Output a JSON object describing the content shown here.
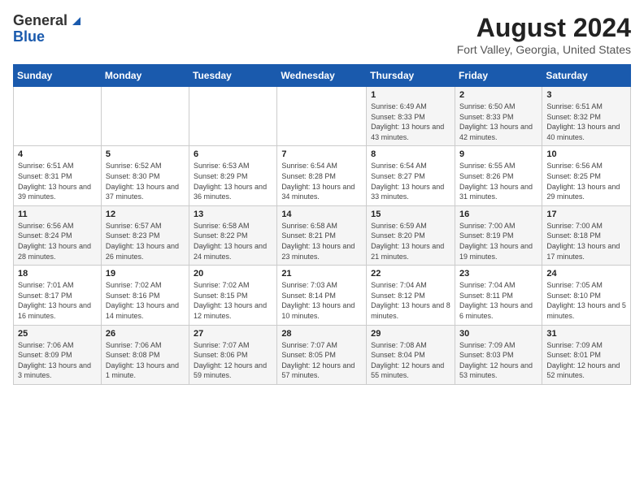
{
  "header": {
    "logo_general": "General",
    "logo_blue": "Blue",
    "month_title": "August 2024",
    "location": "Fort Valley, Georgia, United States"
  },
  "weekdays": [
    "Sunday",
    "Monday",
    "Tuesday",
    "Wednesday",
    "Thursday",
    "Friday",
    "Saturday"
  ],
  "weeks": [
    [
      {
        "day": "",
        "sunrise": "",
        "sunset": "",
        "daylight": ""
      },
      {
        "day": "",
        "sunrise": "",
        "sunset": "",
        "daylight": ""
      },
      {
        "day": "",
        "sunrise": "",
        "sunset": "",
        "daylight": ""
      },
      {
        "day": "",
        "sunrise": "",
        "sunset": "",
        "daylight": ""
      },
      {
        "day": "1",
        "sunrise": "Sunrise: 6:49 AM",
        "sunset": "Sunset: 8:33 PM",
        "daylight": "Daylight: 13 hours and 43 minutes."
      },
      {
        "day": "2",
        "sunrise": "Sunrise: 6:50 AM",
        "sunset": "Sunset: 8:33 PM",
        "daylight": "Daylight: 13 hours and 42 minutes."
      },
      {
        "day": "3",
        "sunrise": "Sunrise: 6:51 AM",
        "sunset": "Sunset: 8:32 PM",
        "daylight": "Daylight: 13 hours and 40 minutes."
      }
    ],
    [
      {
        "day": "4",
        "sunrise": "Sunrise: 6:51 AM",
        "sunset": "Sunset: 8:31 PM",
        "daylight": "Daylight: 13 hours and 39 minutes."
      },
      {
        "day": "5",
        "sunrise": "Sunrise: 6:52 AM",
        "sunset": "Sunset: 8:30 PM",
        "daylight": "Daylight: 13 hours and 37 minutes."
      },
      {
        "day": "6",
        "sunrise": "Sunrise: 6:53 AM",
        "sunset": "Sunset: 8:29 PM",
        "daylight": "Daylight: 13 hours and 36 minutes."
      },
      {
        "day": "7",
        "sunrise": "Sunrise: 6:54 AM",
        "sunset": "Sunset: 8:28 PM",
        "daylight": "Daylight: 13 hours and 34 minutes."
      },
      {
        "day": "8",
        "sunrise": "Sunrise: 6:54 AM",
        "sunset": "Sunset: 8:27 PM",
        "daylight": "Daylight: 13 hours and 33 minutes."
      },
      {
        "day": "9",
        "sunrise": "Sunrise: 6:55 AM",
        "sunset": "Sunset: 8:26 PM",
        "daylight": "Daylight: 13 hours and 31 minutes."
      },
      {
        "day": "10",
        "sunrise": "Sunrise: 6:56 AM",
        "sunset": "Sunset: 8:25 PM",
        "daylight": "Daylight: 13 hours and 29 minutes."
      }
    ],
    [
      {
        "day": "11",
        "sunrise": "Sunrise: 6:56 AM",
        "sunset": "Sunset: 8:24 PM",
        "daylight": "Daylight: 13 hours and 28 minutes."
      },
      {
        "day": "12",
        "sunrise": "Sunrise: 6:57 AM",
        "sunset": "Sunset: 8:23 PM",
        "daylight": "Daylight: 13 hours and 26 minutes."
      },
      {
        "day": "13",
        "sunrise": "Sunrise: 6:58 AM",
        "sunset": "Sunset: 8:22 PM",
        "daylight": "Daylight: 13 hours and 24 minutes."
      },
      {
        "day": "14",
        "sunrise": "Sunrise: 6:58 AM",
        "sunset": "Sunset: 8:21 PM",
        "daylight": "Daylight: 13 hours and 23 minutes."
      },
      {
        "day": "15",
        "sunrise": "Sunrise: 6:59 AM",
        "sunset": "Sunset: 8:20 PM",
        "daylight": "Daylight: 13 hours and 21 minutes."
      },
      {
        "day": "16",
        "sunrise": "Sunrise: 7:00 AM",
        "sunset": "Sunset: 8:19 PM",
        "daylight": "Daylight: 13 hours and 19 minutes."
      },
      {
        "day": "17",
        "sunrise": "Sunrise: 7:00 AM",
        "sunset": "Sunset: 8:18 PM",
        "daylight": "Daylight: 13 hours and 17 minutes."
      }
    ],
    [
      {
        "day": "18",
        "sunrise": "Sunrise: 7:01 AM",
        "sunset": "Sunset: 8:17 PM",
        "daylight": "Daylight: 13 hours and 16 minutes."
      },
      {
        "day": "19",
        "sunrise": "Sunrise: 7:02 AM",
        "sunset": "Sunset: 8:16 PM",
        "daylight": "Daylight: 13 hours and 14 minutes."
      },
      {
        "day": "20",
        "sunrise": "Sunrise: 7:02 AM",
        "sunset": "Sunset: 8:15 PM",
        "daylight": "Daylight: 13 hours and 12 minutes."
      },
      {
        "day": "21",
        "sunrise": "Sunrise: 7:03 AM",
        "sunset": "Sunset: 8:14 PM",
        "daylight": "Daylight: 13 hours and 10 minutes."
      },
      {
        "day": "22",
        "sunrise": "Sunrise: 7:04 AM",
        "sunset": "Sunset: 8:12 PM",
        "daylight": "Daylight: 13 hours and 8 minutes."
      },
      {
        "day": "23",
        "sunrise": "Sunrise: 7:04 AM",
        "sunset": "Sunset: 8:11 PM",
        "daylight": "Daylight: 13 hours and 6 minutes."
      },
      {
        "day": "24",
        "sunrise": "Sunrise: 7:05 AM",
        "sunset": "Sunset: 8:10 PM",
        "daylight": "Daylight: 13 hours and 5 minutes."
      }
    ],
    [
      {
        "day": "25",
        "sunrise": "Sunrise: 7:06 AM",
        "sunset": "Sunset: 8:09 PM",
        "daylight": "Daylight: 13 hours and 3 minutes."
      },
      {
        "day": "26",
        "sunrise": "Sunrise: 7:06 AM",
        "sunset": "Sunset: 8:08 PM",
        "daylight": "Daylight: 13 hours and 1 minute."
      },
      {
        "day": "27",
        "sunrise": "Sunrise: 7:07 AM",
        "sunset": "Sunset: 8:06 PM",
        "daylight": "Daylight: 12 hours and 59 minutes."
      },
      {
        "day": "28",
        "sunrise": "Sunrise: 7:07 AM",
        "sunset": "Sunset: 8:05 PM",
        "daylight": "Daylight: 12 hours and 57 minutes."
      },
      {
        "day": "29",
        "sunrise": "Sunrise: 7:08 AM",
        "sunset": "Sunset: 8:04 PM",
        "daylight": "Daylight: 12 hours and 55 minutes."
      },
      {
        "day": "30",
        "sunrise": "Sunrise: 7:09 AM",
        "sunset": "Sunset: 8:03 PM",
        "daylight": "Daylight: 12 hours and 53 minutes."
      },
      {
        "day": "31",
        "sunrise": "Sunrise: 7:09 AM",
        "sunset": "Sunset: 8:01 PM",
        "daylight": "Daylight: 12 hours and 52 minutes."
      }
    ]
  ]
}
